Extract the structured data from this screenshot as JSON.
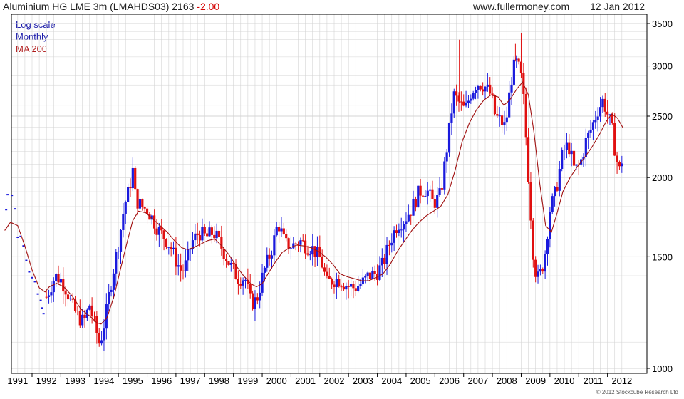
{
  "header": {
    "symbol_text": "Aluminium HG LME 3m (LMAHDS03) 2163",
    "change_text": "-2.00",
    "website": "www.fullermoney.com",
    "date": "12 Jan 2012"
  },
  "legend": [
    {
      "label": "Log scale",
      "color": "#1a1aaa"
    },
    {
      "label": "Monthly",
      "color": "#1a1aaa"
    },
    {
      "label": "MA 200",
      "color": "#b01818"
    }
  ],
  "copyright": "© 2012 Stockcube Research Ltd",
  "colors": {
    "up": "#1a1add",
    "down": "#e01010",
    "ma": "#a01010",
    "grid": "#d4d4d4",
    "axis": "#000000"
  },
  "chart_data": {
    "type": "candlestick",
    "scale": "log",
    "frequency": "monthly",
    "ylim": [
      1000,
      3550
    ],
    "y_ticks": [
      1000,
      1500,
      2000,
      2500,
      3000,
      3500
    ],
    "x_ticks": [
      "1991",
      "1992",
      "1993",
      "1994",
      "1995",
      "1996",
      "1997",
      "1998",
      "1999",
      "2000",
      "2001",
      "2002",
      "2003",
      "2004",
      "2005",
      "2006",
      "2007",
      "2008",
      "2009",
      "2010",
      "2011",
      "2012"
    ],
    "x_range": [
      1990.5,
      2012.05
    ],
    "grid": true,
    "legend_position": "top-left",
    "price_series": [
      [
        1990.75,
        1880
      ],
      [
        1990.95,
        1780
      ],
      [
        1991.15,
        1740
      ],
      [
        1991.35,
        1650
      ],
      [
        1991.55,
        1550
      ],
      [
        1991.75,
        1450
      ],
      [
        1991.95,
        1280
      ],
      [
        1992.1,
        1330
      ],
      [
        1992.3,
        1400
      ],
      [
        1992.5,
        1380
      ],
      [
        1992.7,
        1330
      ],
      [
        1992.9,
        1250
      ],
      [
        1993.1,
        1210
      ],
      [
        1993.3,
        1180
      ],
      [
        1993.5,
        1260
      ],
      [
        1993.7,
        1160
      ],
      [
        1993.85,
        1090
      ],
      [
        1994.05,
        1200
      ],
      [
        1994.2,
        1330
      ],
      [
        1994.35,
        1450
      ],
      [
        1994.55,
        1620
      ],
      [
        1994.7,
        1800
      ],
      [
        1994.85,
        1900
      ],
      [
        1995.0,
        2050
      ],
      [
        1995.1,
        1850
      ],
      [
        1995.3,
        1800
      ],
      [
        1995.5,
        1780
      ],
      [
        1995.7,
        1720
      ],
      [
        1995.9,
        1650
      ],
      [
        1996.1,
        1610
      ],
      [
        1996.3,
        1560
      ],
      [
        1996.5,
        1480
      ],
      [
        1996.7,
        1420
      ],
      [
        1996.85,
        1460
      ],
      [
        1997.05,
        1580
      ],
      [
        1997.3,
        1640
      ],
      [
        1997.55,
        1610
      ],
      [
        1997.8,
        1640
      ],
      [
        1997.95,
        1600
      ],
      [
        1998.15,
        1530
      ],
      [
        1998.4,
        1450
      ],
      [
        1998.65,
        1390
      ],
      [
        1998.9,
        1390
      ],
      [
        1999.1,
        1270
      ],
      [
        1999.3,
        1280
      ],
      [
        1999.55,
        1420
      ],
      [
        1999.85,
        1550
      ],
      [
        2000.05,
        1700
      ],
      [
        2000.3,
        1570
      ],
      [
        2000.55,
        1560
      ],
      [
        2000.8,
        1590
      ],
      [
        2001.05,
        1560
      ],
      [
        2001.3,
        1540
      ],
      [
        2001.55,
        1480
      ],
      [
        2001.75,
        1360
      ],
      [
        2001.95,
        1380
      ],
      [
        2002.2,
        1380
      ],
      [
        2002.45,
        1350
      ],
      [
        2002.7,
        1340
      ],
      [
        2002.95,
        1360
      ],
      [
        2003.2,
        1400
      ],
      [
        2003.45,
        1410
      ],
      [
        2003.7,
        1460
      ],
      [
        2003.95,
        1590
      ],
      [
        2004.2,
        1690
      ],
      [
        2004.45,
        1720
      ],
      [
        2004.7,
        1790
      ],
      [
        2004.95,
        1900
      ],
      [
        2005.2,
        1920
      ],
      [
        2005.45,
        1820
      ],
      [
        2005.7,
        1880
      ],
      [
        2005.95,
        2280
      ],
      [
        2006.15,
        2700
      ],
      [
        2006.35,
        2620
      ],
      [
        2006.55,
        2550
      ],
      [
        2006.75,
        2720
      ],
      [
        2006.95,
        2820
      ],
      [
        2007.2,
        2800
      ],
      [
        2007.45,
        2700
      ],
      [
        2007.6,
        2500
      ],
      [
        2007.8,
        2450
      ],
      [
        2007.95,
        2400
      ],
      [
        2008.15,
        2850
      ],
      [
        2008.3,
        3050
      ],
      [
        2008.45,
        2950
      ],
      [
        2008.55,
        2800
      ],
      [
        2008.7,
        2200
      ],
      [
        2008.85,
        1700
      ],
      [
        2008.95,
        1450
      ],
      [
        2009.1,
        1380
      ],
      [
        2009.3,
        1480
      ],
      [
        2009.5,
        1780
      ],
      [
        2009.7,
        1900
      ],
      [
        2009.95,
        2200
      ],
      [
        2010.15,
        2250
      ],
      [
        2010.35,
        2050
      ],
      [
        2010.55,
        2100
      ],
      [
        2010.75,
        2280
      ],
      [
        2010.95,
        2400
      ],
      [
        2011.15,
        2550
      ],
      [
        2011.35,
        2650
      ],
      [
        2011.5,
        2520
      ],
      [
        2011.65,
        2400
      ],
      [
        2011.8,
        2150
      ],
      [
        2011.92,
        2050
      ],
      [
        2012.03,
        2163
      ]
    ],
    "ma200": [
      [
        1990.55,
        1650
      ],
      [
        1990.75,
        1700
      ],
      [
        1991.0,
        1680
      ],
      [
        1991.25,
        1560
      ],
      [
        1991.5,
        1430
      ],
      [
        1991.75,
        1340
      ],
      [
        1991.95,
        1320
      ],
      [
        1992.1,
        1345
      ],
      [
        1992.35,
        1362
      ],
      [
        1992.6,
        1345
      ],
      [
        1992.9,
        1300
      ],
      [
        1993.2,
        1240
      ],
      [
        1993.5,
        1210
      ],
      [
        1993.75,
        1180
      ],
      [
        1993.9,
        1175
      ],
      [
        1994.1,
        1200
      ],
      [
        1994.35,
        1300
      ],
      [
        1994.55,
        1420
      ],
      [
        1994.8,
        1580
      ],
      [
        1995.0,
        1710
      ],
      [
        1995.2,
        1770
      ],
      [
        1995.45,
        1760
      ],
      [
        1995.7,
        1720
      ],
      [
        1995.95,
        1680
      ],
      [
        1996.2,
        1640
      ],
      [
        1996.45,
        1590
      ],
      [
        1996.7,
        1550
      ],
      [
        1996.9,
        1540
      ],
      [
        1997.1,
        1550
      ],
      [
        1997.35,
        1570
      ],
      [
        1997.6,
        1590
      ],
      [
        1997.85,
        1600
      ],
      [
        1998.1,
        1560
      ],
      [
        1998.35,
        1510
      ],
      [
        1998.6,
        1450
      ],
      [
        1998.85,
        1400
      ],
      [
        1999.1,
        1360
      ],
      [
        1999.3,
        1345
      ],
      [
        1999.5,
        1360
      ],
      [
        1999.7,
        1410
      ],
      [
        1999.95,
        1470
      ],
      [
        2000.2,
        1525
      ],
      [
        2000.45,
        1550
      ],
      [
        2000.7,
        1565
      ],
      [
        2000.95,
        1560
      ],
      [
        2001.2,
        1550
      ],
      [
        2001.45,
        1530
      ],
      [
        2001.7,
        1500
      ],
      [
        2001.95,
        1460
      ],
      [
        2002.2,
        1410
      ],
      [
        2002.45,
        1395
      ],
      [
        2002.7,
        1385
      ],
      [
        2002.95,
        1375
      ],
      [
        2003.2,
        1375
      ],
      [
        2003.45,
        1390
      ],
      [
        2003.7,
        1410
      ],
      [
        2003.95,
        1460
      ],
      [
        2004.2,
        1530
      ],
      [
        2004.45,
        1590
      ],
      [
        2004.7,
        1650
      ],
      [
        2004.95,
        1700
      ],
      [
        2005.2,
        1740
      ],
      [
        2005.45,
        1770
      ],
      [
        2005.7,
        1800
      ],
      [
        2005.95,
        1880
      ],
      [
        2006.2,
        2050
      ],
      [
        2006.45,
        2280
      ],
      [
        2006.7,
        2440
      ],
      [
        2006.95,
        2560
      ],
      [
        2007.2,
        2650
      ],
      [
        2007.45,
        2700
      ],
      [
        2007.7,
        2680
      ],
      [
        2007.9,
        2600
      ],
      [
        2008.1,
        2650
      ],
      [
        2008.35,
        2760
      ],
      [
        2008.55,
        2830
      ],
      [
        2008.75,
        2700
      ],
      [
        2008.95,
        2350
      ],
      [
        2009.15,
        1950
      ],
      [
        2009.35,
        1680
      ],
      [
        2009.55,
        1640
      ],
      [
        2009.75,
        1760
      ],
      [
        2009.95,
        1900
      ],
      [
        2010.2,
        2000
      ],
      [
        2010.45,
        2080
      ],
      [
        2010.7,
        2150
      ],
      [
        2010.95,
        2230
      ],
      [
        2011.2,
        2330
      ],
      [
        2011.45,
        2450
      ],
      [
        2011.65,
        2520
      ],
      [
        2011.85,
        2480
      ],
      [
        2012.03,
        2400
      ]
    ],
    "early_dots": [
      [
        1990.65,
        1880
      ],
      [
        1990.8,
        1875
      ],
      [
        1990.9,
        1785
      ],
      [
        1990.6,
        1780
      ],
      [
        1991.0,
        1610
      ],
      [
        1991.1,
        1615
      ],
      [
        1991.2,
        1560
      ],
      [
        1991.3,
        1480
      ],
      [
        1991.4,
        1420
      ],
      [
        1991.5,
        1390
      ],
      [
        1991.6,
        1370
      ],
      [
        1991.7,
        1310
      ],
      [
        1991.8,
        1280
      ],
      [
        1991.85,
        1245
      ],
      [
        1991.9,
        1220
      ]
    ]
  }
}
